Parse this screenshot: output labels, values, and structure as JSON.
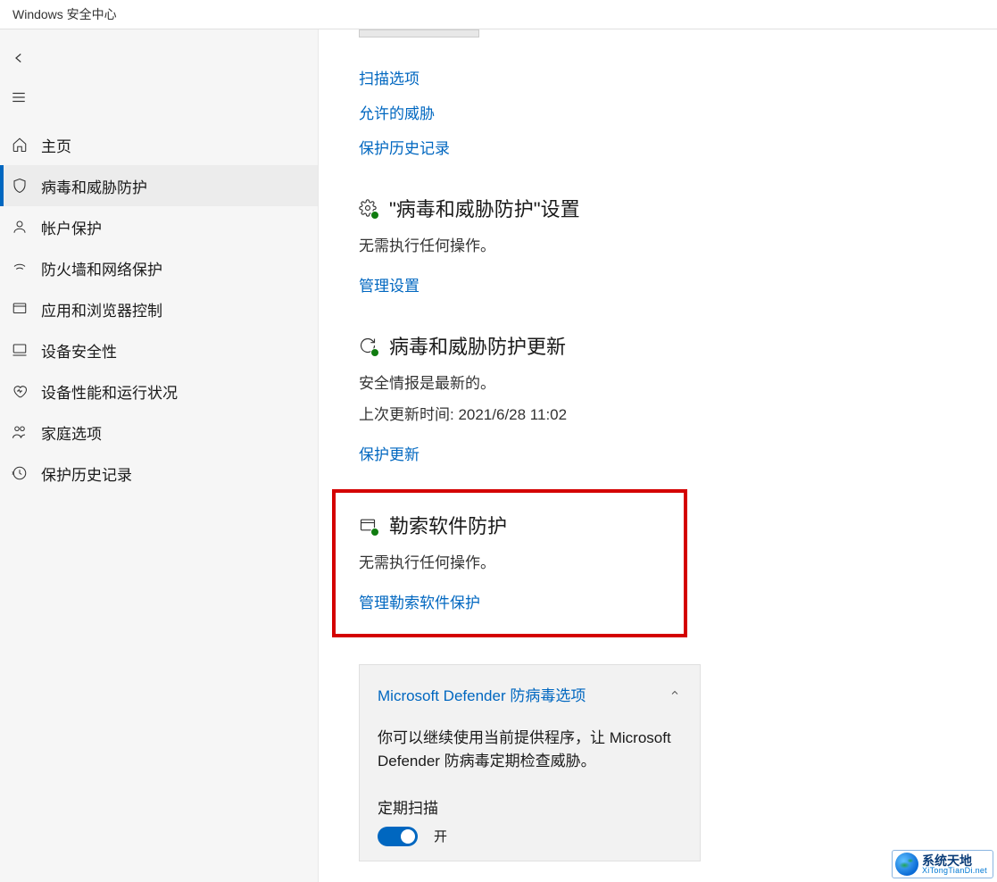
{
  "window": {
    "title": "Windows 安全中心"
  },
  "sidebar": {
    "items": [
      {
        "icon": "home",
        "label": "主页"
      },
      {
        "icon": "shield",
        "label": "病毒和威胁防护"
      },
      {
        "icon": "person",
        "label": "帐户保护"
      },
      {
        "icon": "wifi",
        "label": "防火墙和网络保护"
      },
      {
        "icon": "app",
        "label": "应用和浏览器控制"
      },
      {
        "icon": "device",
        "label": "设备安全性"
      },
      {
        "icon": "health",
        "label": "设备性能和运行状况"
      },
      {
        "icon": "family",
        "label": "家庭选项"
      },
      {
        "icon": "history",
        "label": "保护历史记录"
      }
    ],
    "active_index": 1
  },
  "links": {
    "scan_options": "扫描选项",
    "allowed_threats": "允许的威胁",
    "protection_history": "保护历史记录"
  },
  "settings": {
    "title": "\"病毒和威胁防护\"设置",
    "desc": "无需执行任何操作。",
    "manage": "管理设置"
  },
  "updates": {
    "title": "病毒和威胁防护更新",
    "desc": "安全情报是最新的。",
    "last": "上次更新时间: 2021/6/28 11:02",
    "link": "保护更新"
  },
  "ransomware": {
    "title": "勒索软件防护",
    "desc": "无需执行任何操作。",
    "link": "管理勒索软件保护"
  },
  "defender_card": {
    "title": "Microsoft Defender 防病毒选项",
    "body": "你可以继续使用当前提供程序，让 Microsoft Defender 防病毒定期检查威胁。",
    "toggle_label": "定期扫描",
    "toggle_state": "开"
  },
  "watermark": {
    "line1": "系统天地",
    "line2": "XiTongTianDi.net"
  }
}
